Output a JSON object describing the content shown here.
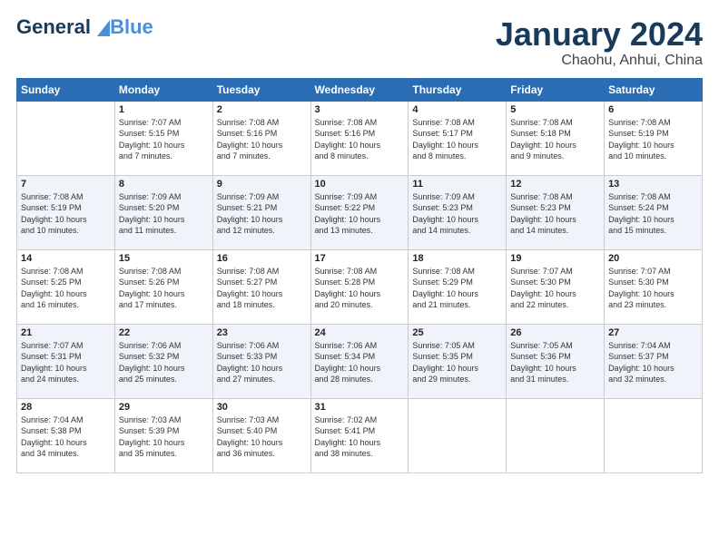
{
  "header": {
    "logo_general": "General",
    "logo_blue": "Blue",
    "title": "January 2024",
    "subtitle": "Chaohu, Anhui, China"
  },
  "days_of_week": [
    "Sunday",
    "Monday",
    "Tuesday",
    "Wednesday",
    "Thursday",
    "Friday",
    "Saturday"
  ],
  "weeks": [
    [
      {
        "day": "",
        "info": ""
      },
      {
        "day": "1",
        "info": "Sunrise: 7:07 AM\nSunset: 5:15 PM\nDaylight: 10 hours\nand 7 minutes."
      },
      {
        "day": "2",
        "info": "Sunrise: 7:08 AM\nSunset: 5:16 PM\nDaylight: 10 hours\nand 7 minutes."
      },
      {
        "day": "3",
        "info": "Sunrise: 7:08 AM\nSunset: 5:16 PM\nDaylight: 10 hours\nand 8 minutes."
      },
      {
        "day": "4",
        "info": "Sunrise: 7:08 AM\nSunset: 5:17 PM\nDaylight: 10 hours\nand 8 minutes."
      },
      {
        "day": "5",
        "info": "Sunrise: 7:08 AM\nSunset: 5:18 PM\nDaylight: 10 hours\nand 9 minutes."
      },
      {
        "day": "6",
        "info": "Sunrise: 7:08 AM\nSunset: 5:19 PM\nDaylight: 10 hours\nand 10 minutes."
      }
    ],
    [
      {
        "day": "7",
        "info": "Sunrise: 7:08 AM\nSunset: 5:19 PM\nDaylight: 10 hours\nand 10 minutes."
      },
      {
        "day": "8",
        "info": "Sunrise: 7:09 AM\nSunset: 5:20 PM\nDaylight: 10 hours\nand 11 minutes."
      },
      {
        "day": "9",
        "info": "Sunrise: 7:09 AM\nSunset: 5:21 PM\nDaylight: 10 hours\nand 12 minutes."
      },
      {
        "day": "10",
        "info": "Sunrise: 7:09 AM\nSunset: 5:22 PM\nDaylight: 10 hours\nand 13 minutes."
      },
      {
        "day": "11",
        "info": "Sunrise: 7:09 AM\nSunset: 5:23 PM\nDaylight: 10 hours\nand 14 minutes."
      },
      {
        "day": "12",
        "info": "Sunrise: 7:08 AM\nSunset: 5:23 PM\nDaylight: 10 hours\nand 14 minutes."
      },
      {
        "day": "13",
        "info": "Sunrise: 7:08 AM\nSunset: 5:24 PM\nDaylight: 10 hours\nand 15 minutes."
      }
    ],
    [
      {
        "day": "14",
        "info": "Sunrise: 7:08 AM\nSunset: 5:25 PM\nDaylight: 10 hours\nand 16 minutes."
      },
      {
        "day": "15",
        "info": "Sunrise: 7:08 AM\nSunset: 5:26 PM\nDaylight: 10 hours\nand 17 minutes."
      },
      {
        "day": "16",
        "info": "Sunrise: 7:08 AM\nSunset: 5:27 PM\nDaylight: 10 hours\nand 18 minutes."
      },
      {
        "day": "17",
        "info": "Sunrise: 7:08 AM\nSunset: 5:28 PM\nDaylight: 10 hours\nand 20 minutes."
      },
      {
        "day": "18",
        "info": "Sunrise: 7:08 AM\nSunset: 5:29 PM\nDaylight: 10 hours\nand 21 minutes."
      },
      {
        "day": "19",
        "info": "Sunrise: 7:07 AM\nSunset: 5:30 PM\nDaylight: 10 hours\nand 22 minutes."
      },
      {
        "day": "20",
        "info": "Sunrise: 7:07 AM\nSunset: 5:30 PM\nDaylight: 10 hours\nand 23 minutes."
      }
    ],
    [
      {
        "day": "21",
        "info": "Sunrise: 7:07 AM\nSunset: 5:31 PM\nDaylight: 10 hours\nand 24 minutes."
      },
      {
        "day": "22",
        "info": "Sunrise: 7:06 AM\nSunset: 5:32 PM\nDaylight: 10 hours\nand 25 minutes."
      },
      {
        "day": "23",
        "info": "Sunrise: 7:06 AM\nSunset: 5:33 PM\nDaylight: 10 hours\nand 27 minutes."
      },
      {
        "day": "24",
        "info": "Sunrise: 7:06 AM\nSunset: 5:34 PM\nDaylight: 10 hours\nand 28 minutes."
      },
      {
        "day": "25",
        "info": "Sunrise: 7:05 AM\nSunset: 5:35 PM\nDaylight: 10 hours\nand 29 minutes."
      },
      {
        "day": "26",
        "info": "Sunrise: 7:05 AM\nSunset: 5:36 PM\nDaylight: 10 hours\nand 31 minutes."
      },
      {
        "day": "27",
        "info": "Sunrise: 7:04 AM\nSunset: 5:37 PM\nDaylight: 10 hours\nand 32 minutes."
      }
    ],
    [
      {
        "day": "28",
        "info": "Sunrise: 7:04 AM\nSunset: 5:38 PM\nDaylight: 10 hours\nand 34 minutes."
      },
      {
        "day": "29",
        "info": "Sunrise: 7:03 AM\nSunset: 5:39 PM\nDaylight: 10 hours\nand 35 minutes."
      },
      {
        "day": "30",
        "info": "Sunrise: 7:03 AM\nSunset: 5:40 PM\nDaylight: 10 hours\nand 36 minutes."
      },
      {
        "day": "31",
        "info": "Sunrise: 7:02 AM\nSunset: 5:41 PM\nDaylight: 10 hours\nand 38 minutes."
      },
      {
        "day": "",
        "info": ""
      },
      {
        "day": "",
        "info": ""
      },
      {
        "day": "",
        "info": ""
      }
    ]
  ]
}
